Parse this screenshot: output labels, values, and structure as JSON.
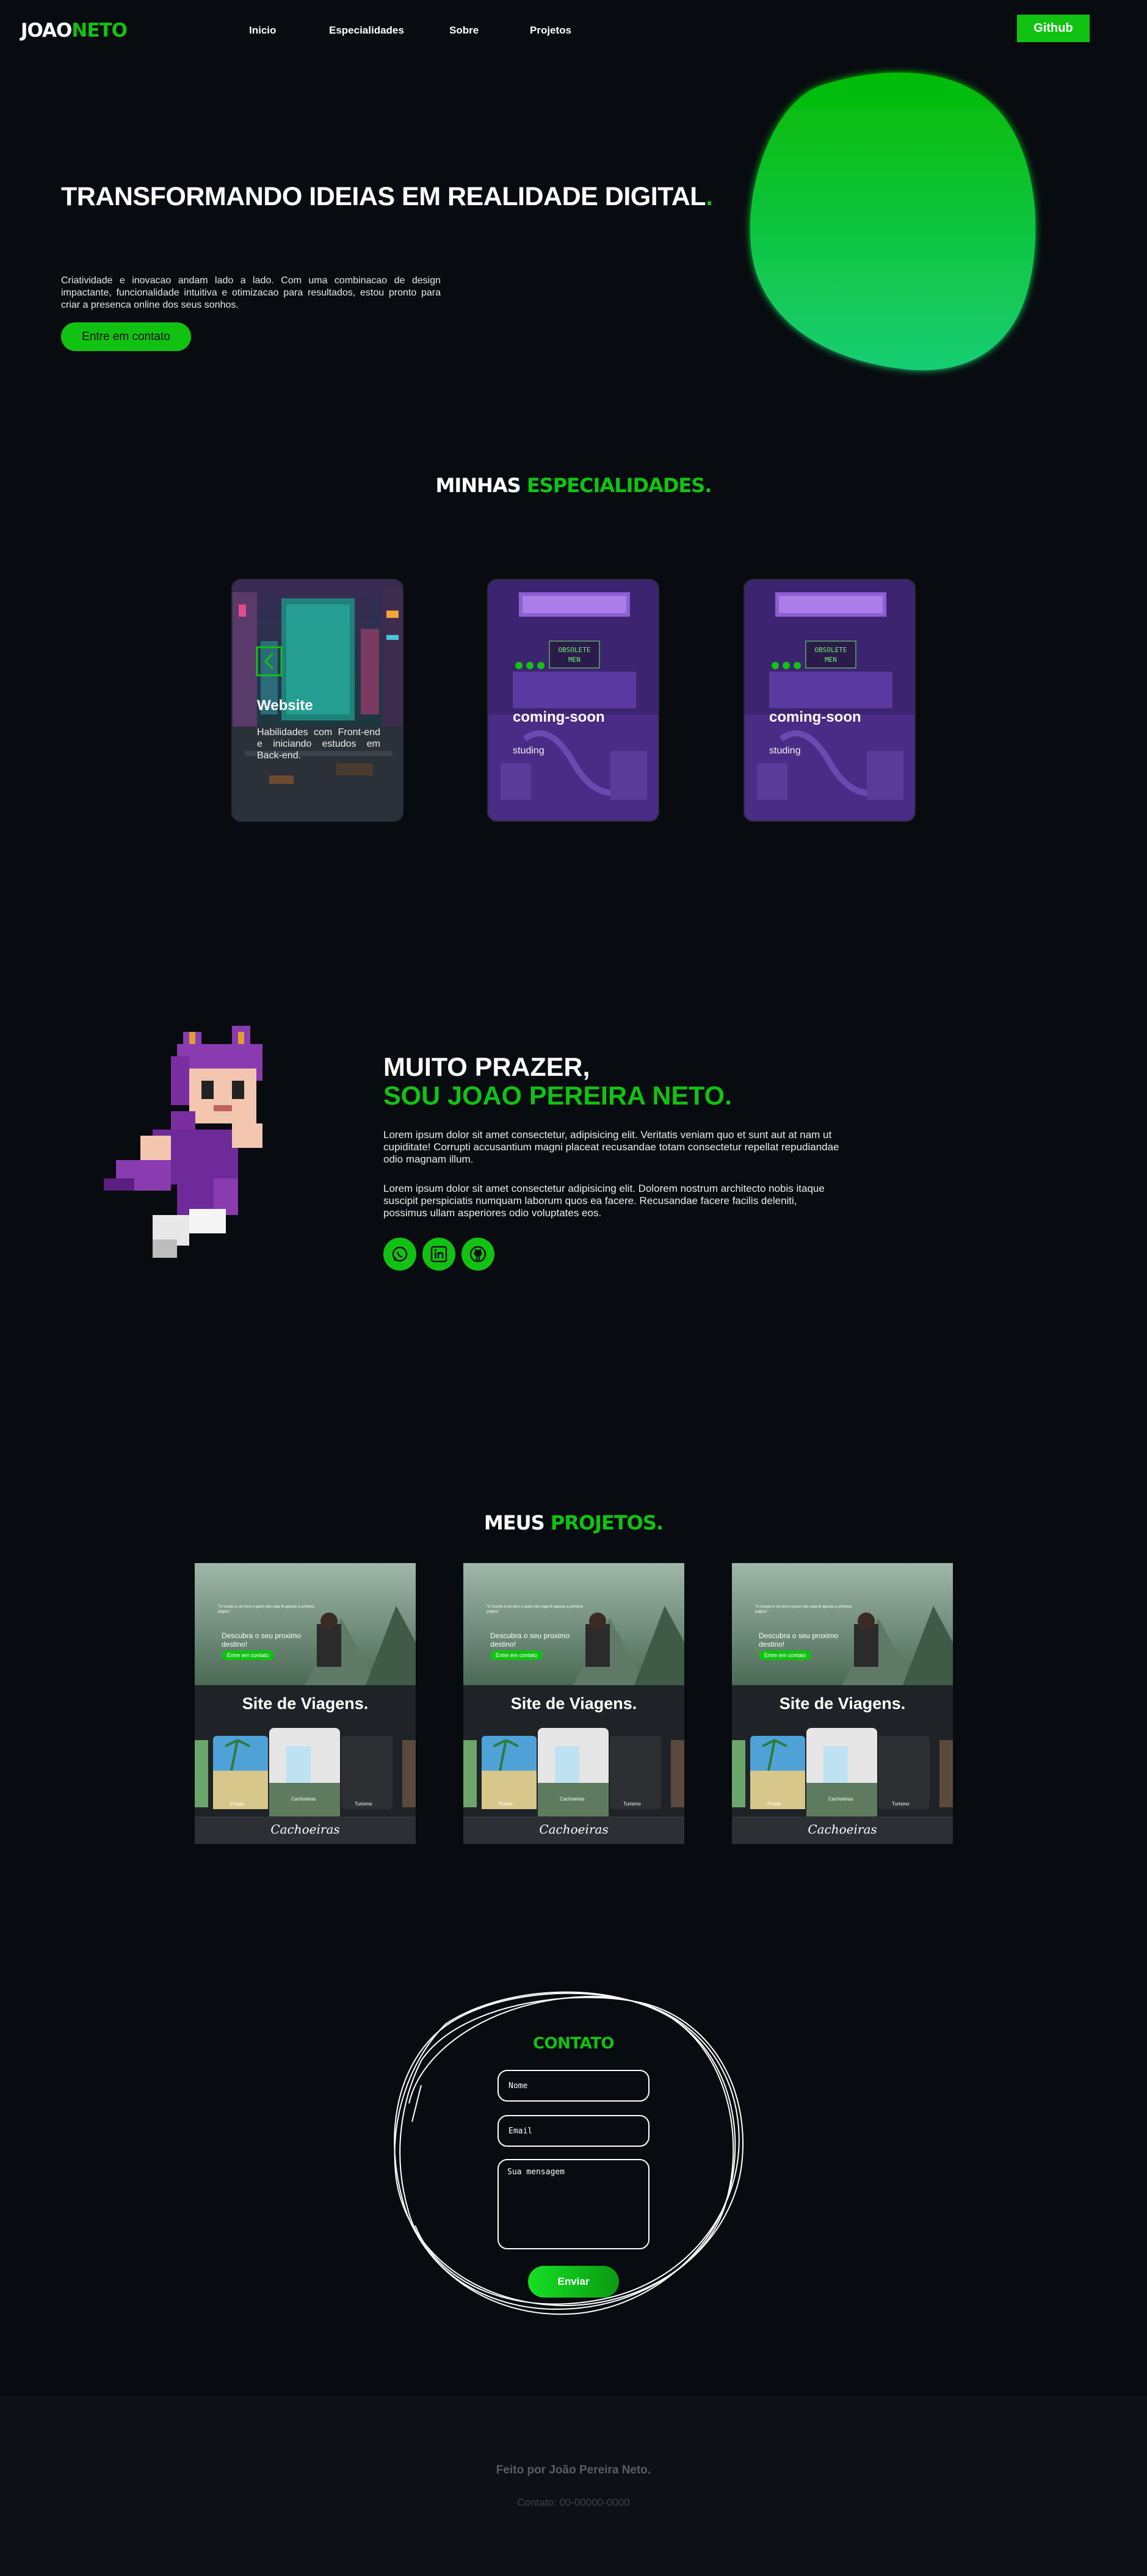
{
  "header": {
    "logo_part1": "JOAO",
    "logo_part2": "NETO",
    "nav": [
      "Inicio",
      "Especialidades",
      "Sobre",
      "Projetos"
    ],
    "github_label": "Github"
  },
  "hero": {
    "title": "TRANSFORMANDO IDEIAS EM REALIDADE DIGITAL",
    "title_dot": ".",
    "description": "Criatividade e inovacao andam lado a lado. Com uma combinacao de design impactante, funcionalidade intuitiva e otimizacao para resultados, estou pronto para criar a presenca online dos seus sonhos.",
    "cta_label": "Entre em contato"
  },
  "specialties": {
    "title_part1": "MINHAS ",
    "title_part2": "ESPECIALIDADES.",
    "cards": [
      {
        "title": "Website",
        "subtitle": "Habilidades com Front-end e iniciando estudos em Back-end."
      },
      {
        "title": "coming-soon",
        "subtitle": "studing",
        "sign_line1": "OBSOLETE",
        "sign_line2": "MEN"
      },
      {
        "title": "coming-soon",
        "subtitle": "studing",
        "sign_line1": "OBSOLETE",
        "sign_line2": "MEN"
      }
    ]
  },
  "about": {
    "title_line1": "MUITO PRAZER,",
    "title_line2": "SOU JOAO PEREIRA NETO.",
    "paragraph1": "Lorem ipsum dolor sit amet consectetur, adipisicing elit. Veritatis veniam quo et sunt aut at nam ut cupiditate! Corrupti accusantium magni placeat recusandae totam consectetur repellat repudiandae odio magnam illum.",
    "paragraph2": "Lorem ipsum dolor sit amet consectetur adipisicing elit. Dolorem nostrum architecto nobis itaque suscipit perspiciatis numquam laborum quos ea facere. Recusandae facere facilis deleniti, possimus ullam asperiores odio voluptates eos.",
    "social_icons": [
      "whatsapp-icon",
      "linkedin-icon",
      "github-icon"
    ]
  },
  "projects": {
    "title_part1": "MEUS ",
    "title_part2": "PROJETOS.",
    "cards": [
      {
        "preview_quote": "\"O mundo é um livro e quem não viaja lê apenas a primeira página.\"",
        "preview_text": "Descubra o seu proximo destino!",
        "preview_cta": "Entre em contato",
        "title": "Site de Viagens.",
        "tiles": [
          "Praias",
          "Cachoeiras",
          "Turismo"
        ],
        "script_label": "Cachoeiras"
      },
      {
        "preview_quote": "\"O mundo é um livro e quem não viaja lê apenas a primeira página.\"",
        "preview_text": "Descubra o seu proximo destino!",
        "preview_cta": "Entre em contato",
        "title": "Site de Viagens.",
        "tiles": [
          "Praias",
          "Cachoeiras",
          "Turismo"
        ],
        "script_label": "Cachoeiras"
      },
      {
        "preview_quote": "\"O mundo é um livro e quem não viaja lê apenas a primeira página.\"",
        "preview_text": "Descubra o seu proximo destino!",
        "preview_cta": "Entre em contato",
        "title": "Site de Viagens.",
        "tiles": [
          "Praias",
          "Cachoeiras",
          "Turismo"
        ],
        "script_label": "Cachoeiras"
      }
    ]
  },
  "contact": {
    "title": "CONTATO",
    "name_placeholder": "Nome",
    "email_placeholder": "Email",
    "message_placeholder": "Sua mensagem",
    "send_label": "Enviar"
  },
  "footer": {
    "credit": "Feito por João Pereira Neto.",
    "contact": "Contato: 00-00000-0000"
  },
  "colors": {
    "accent": "#11c213",
    "background": "#080b10",
    "footer_bg": "#0d1117"
  }
}
